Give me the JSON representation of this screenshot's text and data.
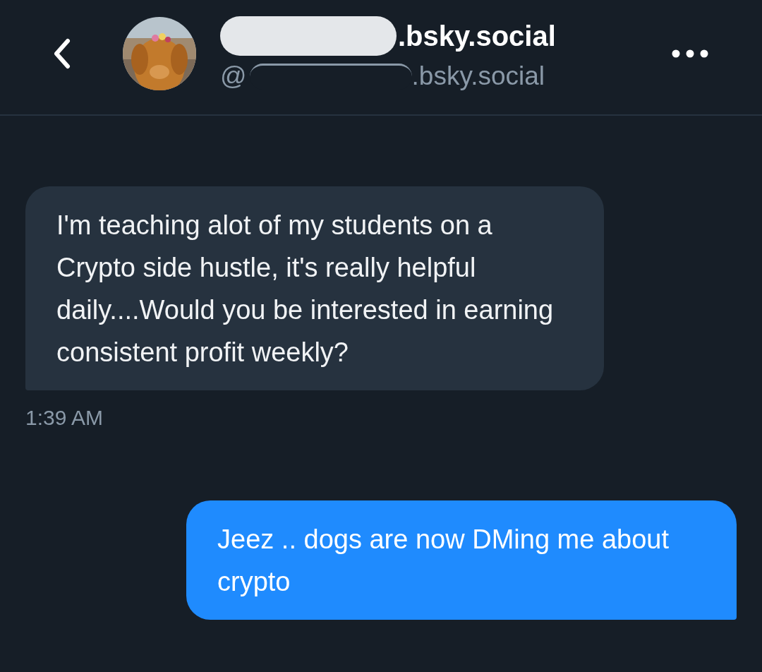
{
  "header": {
    "display_name": ".bsky.social",
    "handle_prefix": "@",
    "handle": ".bsky.social",
    "redacted": true
  },
  "messages": [
    {
      "kind": "incoming",
      "text": "I'm teaching alot of my students on a Crypto side hustle, it's really helpful daily....Would you be interested in earning consistent profit weekly?",
      "time": "1:39 AM"
    },
    {
      "kind": "outgoing",
      "text": "Jeez .. dogs are now DMing me about crypto"
    }
  ]
}
